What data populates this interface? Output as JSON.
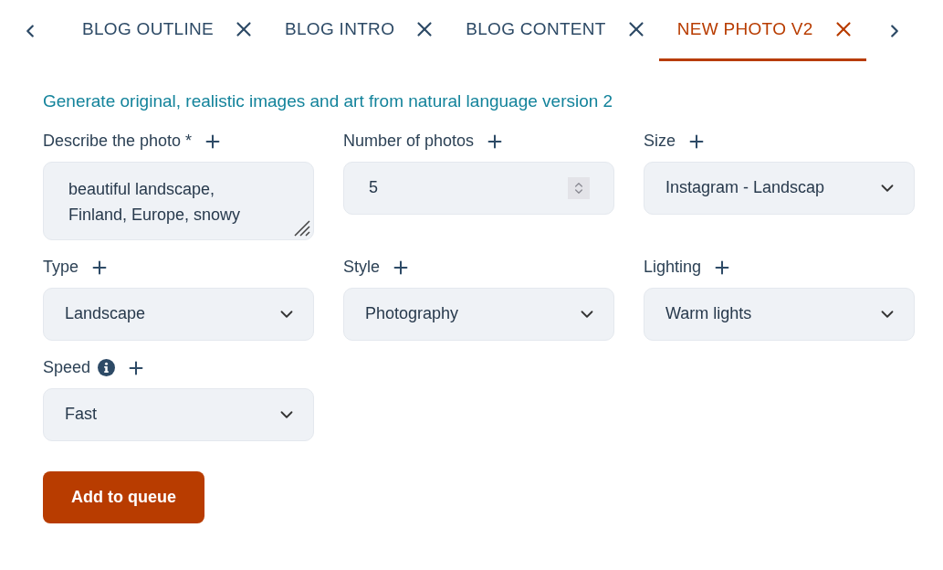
{
  "tabs": [
    {
      "label": "BLOG OUTLINE",
      "selected": false
    },
    {
      "label": "BLOG INTRO",
      "selected": false
    },
    {
      "label": "BLOG CONTENT",
      "selected": false
    },
    {
      "label": "NEW PHOTO V2",
      "selected": true
    }
  ],
  "subtitle": "Generate original, realistic images and art from natural language version 2",
  "fields": [
    {
      "kind": "textarea",
      "label": "Describe the photo *",
      "value": "beautiful landscape, Finland, Europe, snowy",
      "info": false
    },
    {
      "kind": "number",
      "label": "Number of photos",
      "value": "5",
      "info": false
    },
    {
      "kind": "select",
      "label": "Size",
      "value": "Instagram - Landscap",
      "info": false
    },
    {
      "kind": "select",
      "label": "Type",
      "value": "Landscape",
      "info": false
    },
    {
      "kind": "select",
      "label": "Style",
      "value": "Photography",
      "info": false
    },
    {
      "kind": "select",
      "label": "Lighting",
      "value": "Warm lights",
      "info": false
    },
    {
      "kind": "select",
      "label": "Speed",
      "value": "Fast",
      "info": true
    }
  ],
  "submit": "Add to queue"
}
